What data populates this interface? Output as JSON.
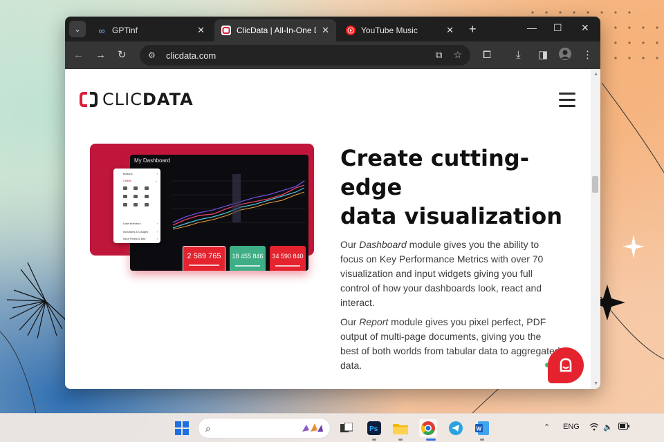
{
  "browser": {
    "tabs": [
      {
        "title": "GPTinf",
        "icon": "infinity-icon",
        "active": false
      },
      {
        "title": "ClicData | All-In-One Dat",
        "icon": "clicdata-favicon",
        "active": true
      },
      {
        "title": "YouTube Music",
        "icon": "youtube-music-icon",
        "active": false
      }
    ],
    "url": "clicdata.com"
  },
  "site": {
    "logo_left": "CLIC",
    "logo_right": "DATA",
    "dashboard": {
      "title": "My Dashboard",
      "kpi1": "2 589 765",
      "kpi2": "18 455 846",
      "kpi3": "34 590 840",
      "menu": [
        "Buttons",
        "Charts",
        "Date selectors",
        "Indicators & Gauges",
        "Input Fields & lists"
      ]
    },
    "headline": [
      "Create cutting-",
      "edge",
      "data visualization"
    ],
    "para1_a": "Our ",
    "para1_em": "Dashboard",
    "para1_b": " module gives you the ability to focus on Key Performance Metrics with over 70 visualization and input widgets giving you full control of how your dashboards look, react and interact.",
    "para2_a": "Our ",
    "para2_em": "Report",
    "para2_b": " module gives you pixel perfect, PDF output of multi-page documents, giving you the best of both worlds from tabular data to aggregated data."
  },
  "taskbar": {
    "language": "ENG"
  },
  "colors": {
    "brand_red": "#c0163b",
    "kpi_red": "#e4232f",
    "kpi_green": "#3fae86"
  }
}
